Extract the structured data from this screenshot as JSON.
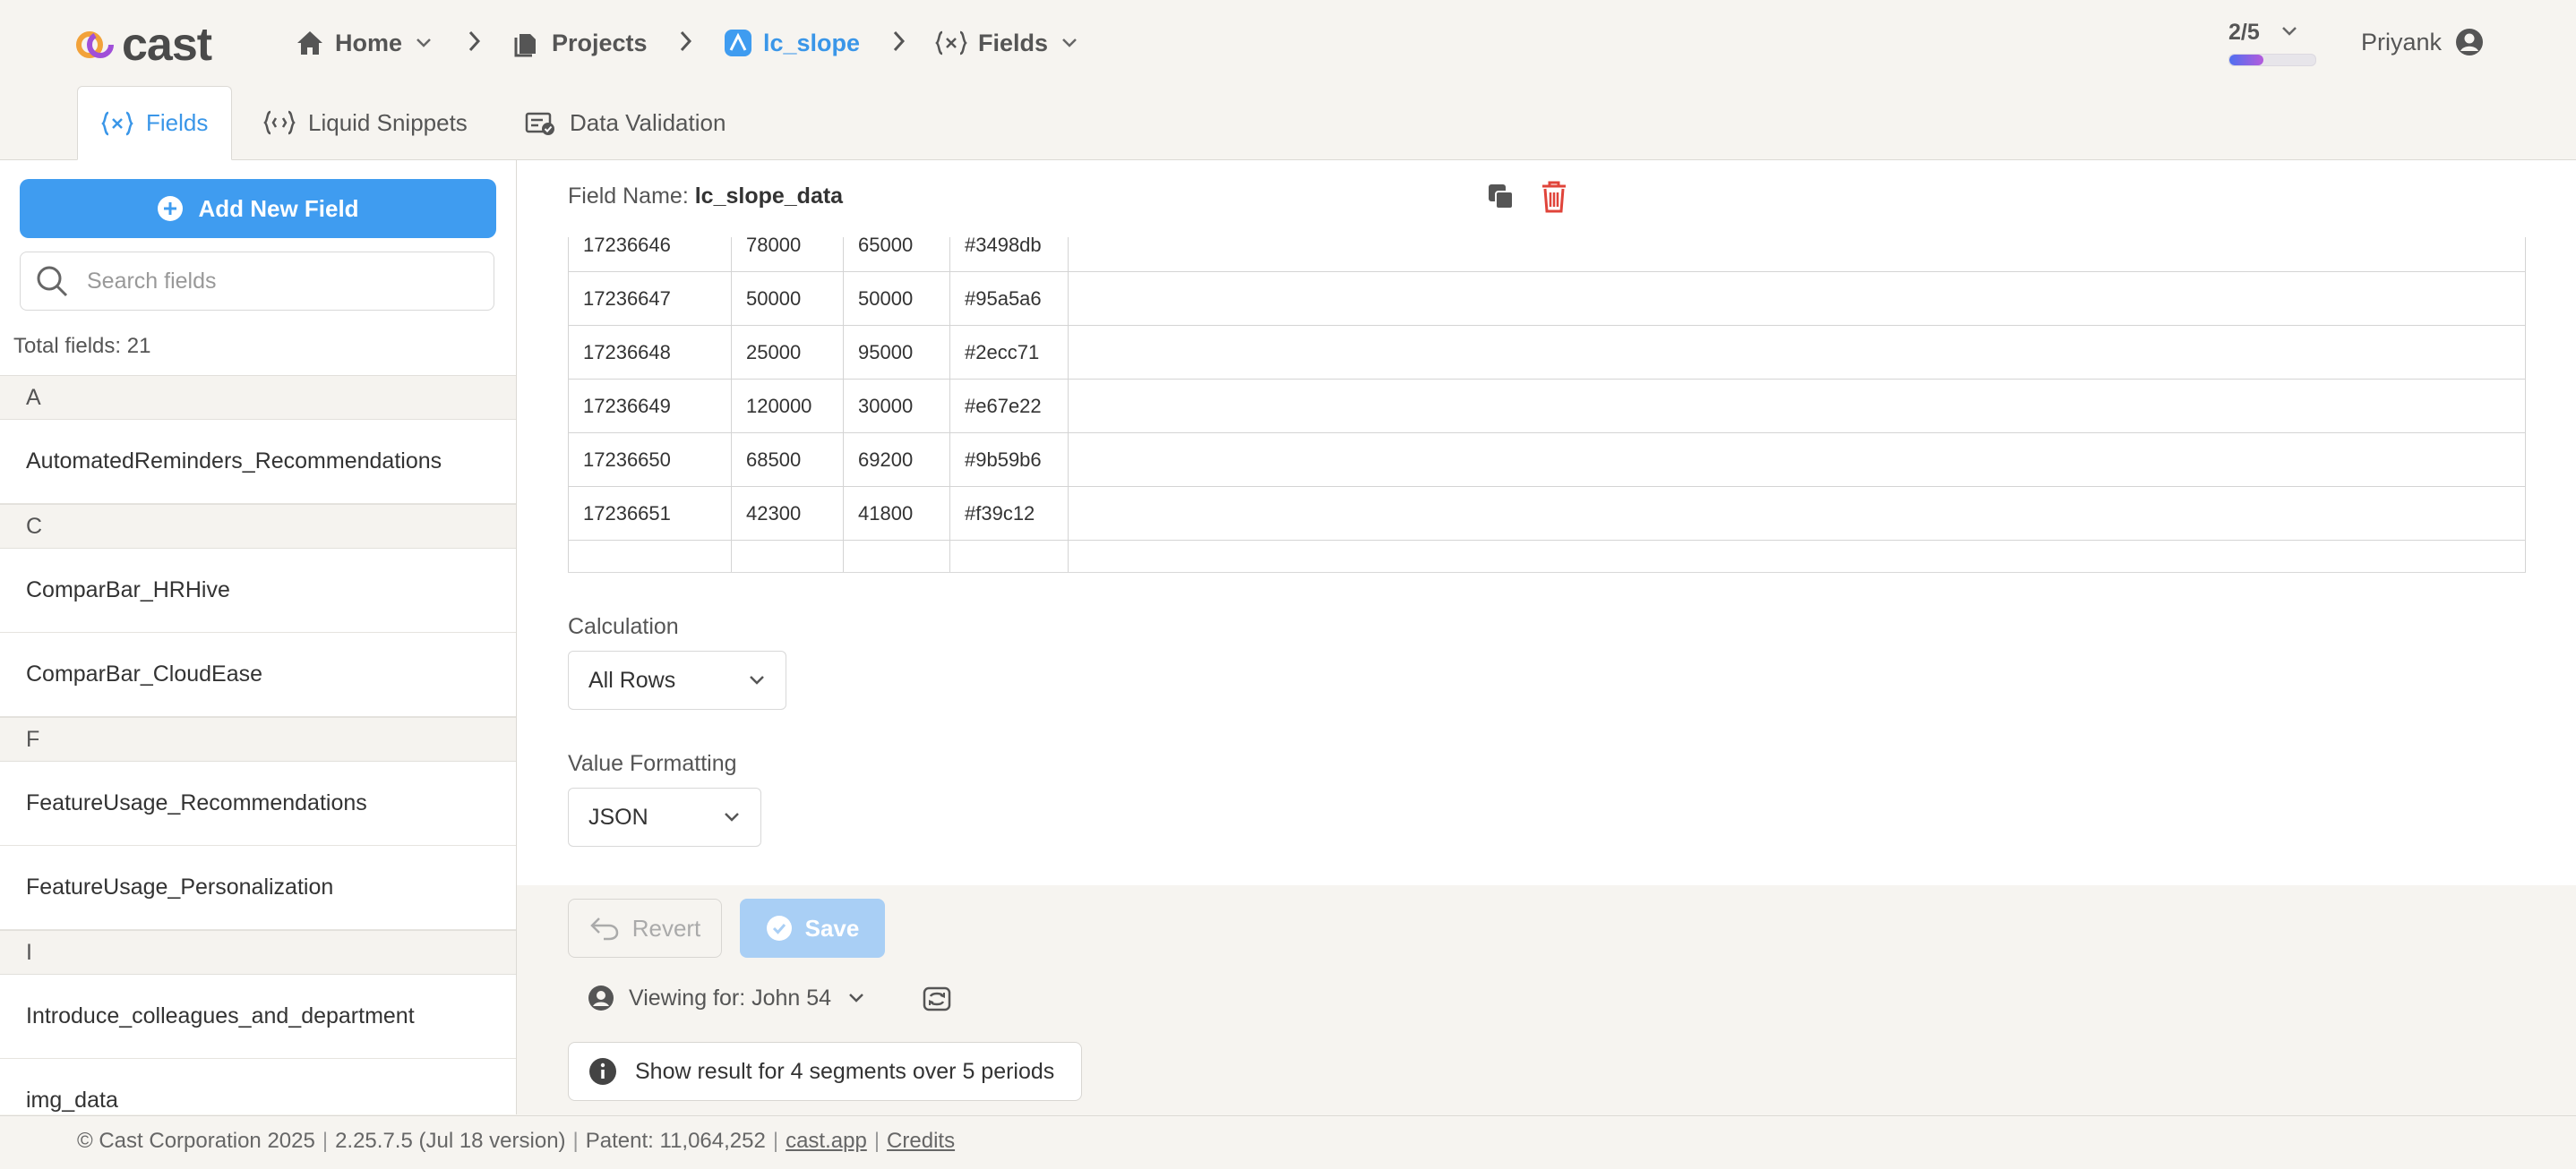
{
  "header": {
    "logo_text": "cast",
    "breadcrumbs": [
      {
        "label": "Home",
        "icon": "home-icon"
      },
      {
        "label": "Projects",
        "icon": "projects-icon"
      },
      {
        "label": "lc_slope",
        "icon": "slope-icon"
      },
      {
        "label": "Fields",
        "icon": "variable-icon"
      }
    ],
    "progress": {
      "label": "2/5",
      "fraction": 0.4
    },
    "user": "Priyank"
  },
  "tabs": [
    {
      "label": "Fields",
      "active": true
    },
    {
      "label": "Liquid Snippets",
      "active": false
    },
    {
      "label": "Data Validation",
      "active": false
    }
  ],
  "sidebar": {
    "add_button": "Add New Field",
    "search_placeholder": "Search fields",
    "total": "Total fields: 21",
    "groups": [
      {
        "letter": "A",
        "items": [
          "AutomatedReminders_Recommendations"
        ]
      },
      {
        "letter": "C",
        "items": [
          "ComparBar_HRHive",
          "ComparBar_CloudEase"
        ]
      },
      {
        "letter": "F",
        "items": [
          "FeatureUsage_Recommendations",
          "FeatureUsage_Personalization"
        ]
      },
      {
        "letter": "I",
        "items": [
          "Introduce_colleagues_and_department",
          "img_data"
        ]
      }
    ]
  },
  "field": {
    "label": "Field Name:",
    "name": "lc_slope_data",
    "rows": [
      [
        "17236646",
        "78000",
        "65000",
        "#3498db"
      ],
      [
        "17236647",
        "50000",
        "50000",
        "#95a5a6"
      ],
      [
        "17236648",
        "25000",
        "95000",
        "#2ecc71"
      ],
      [
        "17236649",
        "120000",
        "30000",
        "#e67e22"
      ],
      [
        "17236650",
        "68500",
        "69200",
        "#9b59b6"
      ],
      [
        "17236651",
        "42300",
        "41800",
        "#f39c12"
      ]
    ],
    "calculation_label": "Calculation",
    "calculation_value": "All Rows",
    "formatting_label": "Value Formatting",
    "formatting_value": "JSON"
  },
  "actions": {
    "revert": "Revert",
    "save": "Save",
    "viewing": "Viewing for: John 54",
    "segments": "Show result for 4 segments over 5 periods"
  },
  "footer": {
    "copyright": "© Cast Corporation 2025",
    "version": "2.25.7.5 (Jul 18 version)",
    "patent": "Patent: 11,064,252",
    "site": "cast.app",
    "credits": "Credits"
  },
  "colors": {
    "accent": "#3f9cf0",
    "active_tab": "#3a96e8",
    "delete": "#e0443a",
    "save_disabled": "#a9cff5"
  }
}
